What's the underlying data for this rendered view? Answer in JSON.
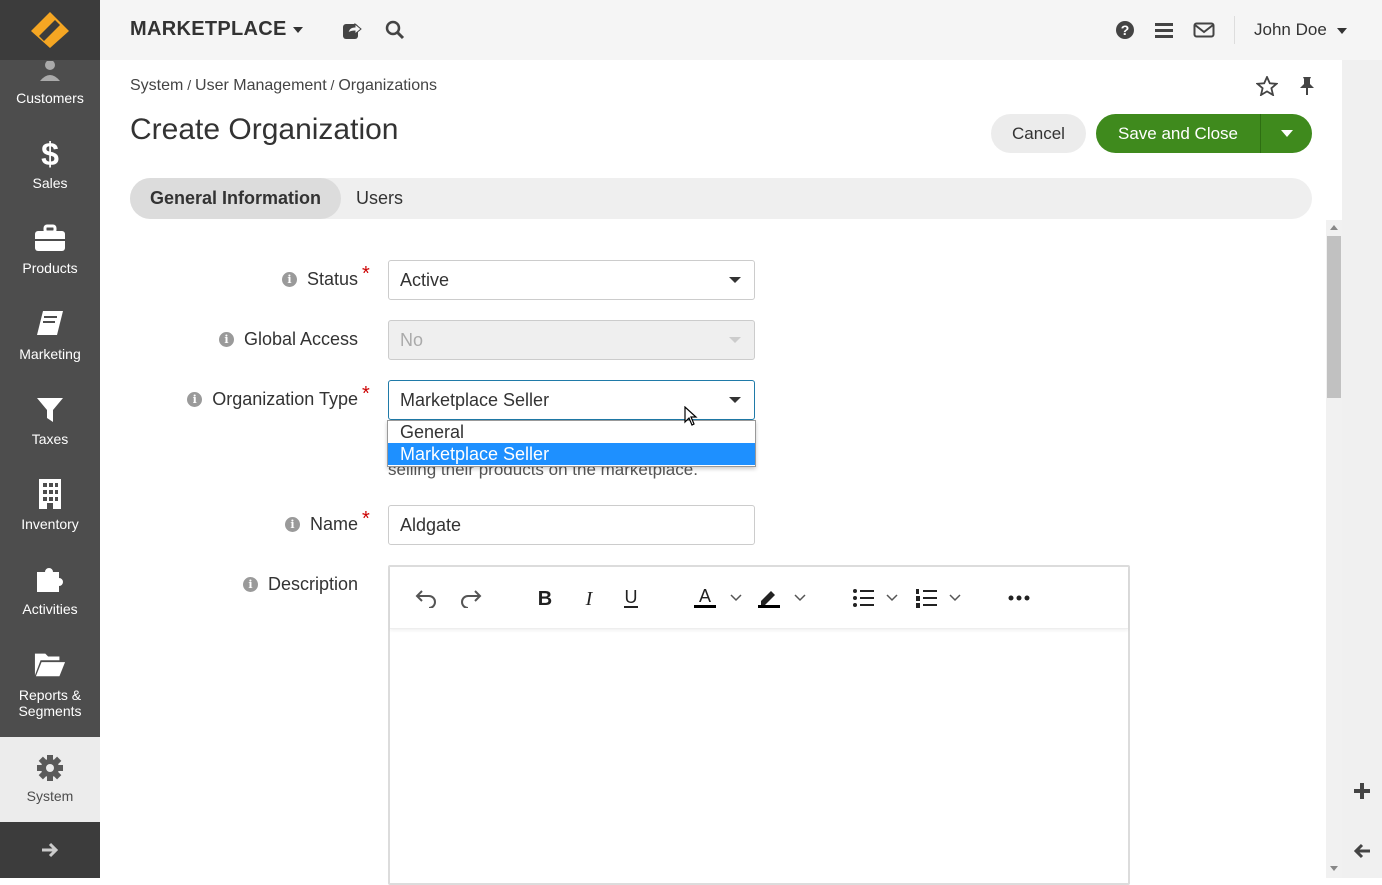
{
  "app": {
    "title": "MARKETPLACE",
    "user_name": "John Doe"
  },
  "sidebar": {
    "items": [
      {
        "label": "Customers",
        "icon": "users-icon"
      },
      {
        "label": "Sales",
        "icon": "dollar-icon"
      },
      {
        "label": "Products",
        "icon": "briefcase-icon"
      },
      {
        "label": "Marketing",
        "icon": "book-icon"
      },
      {
        "label": "Taxes",
        "icon": "filter-icon"
      },
      {
        "label": "Inventory",
        "icon": "building-icon"
      },
      {
        "label": "Activities",
        "icon": "puzzle-icon"
      },
      {
        "label": "Reports &",
        "label2": "Segments",
        "icon": "folder-open-icon"
      },
      {
        "label": "System",
        "icon": "gear-icon"
      }
    ]
  },
  "breadcrumb": {
    "part1": "System",
    "sep": " / ",
    "part2": "User Management",
    "part3": "Organizations"
  },
  "page": {
    "title": "Create Organization"
  },
  "actions": {
    "cancel": "Cancel",
    "save": "Save and Close"
  },
  "tabs": [
    {
      "label": "General Information"
    },
    {
      "label": "Users"
    }
  ],
  "form": {
    "status": {
      "label": "Status",
      "value": "Active"
    },
    "global_access": {
      "label": "Global Access",
      "value": "No"
    },
    "org_type": {
      "label": "Organization Type",
      "value": "Marketplace Seller",
      "hint": "selling their products on the marketplace.",
      "options": [
        "General",
        "Marketplace Seller"
      ]
    },
    "name": {
      "label": "Name",
      "value": "Aldgate"
    },
    "description": {
      "label": "Description"
    }
  },
  "colors": {
    "accent_green": "#3f8a1d",
    "sidebar_bg": "#4d4d4d",
    "selected_option": "#1e90ff"
  }
}
